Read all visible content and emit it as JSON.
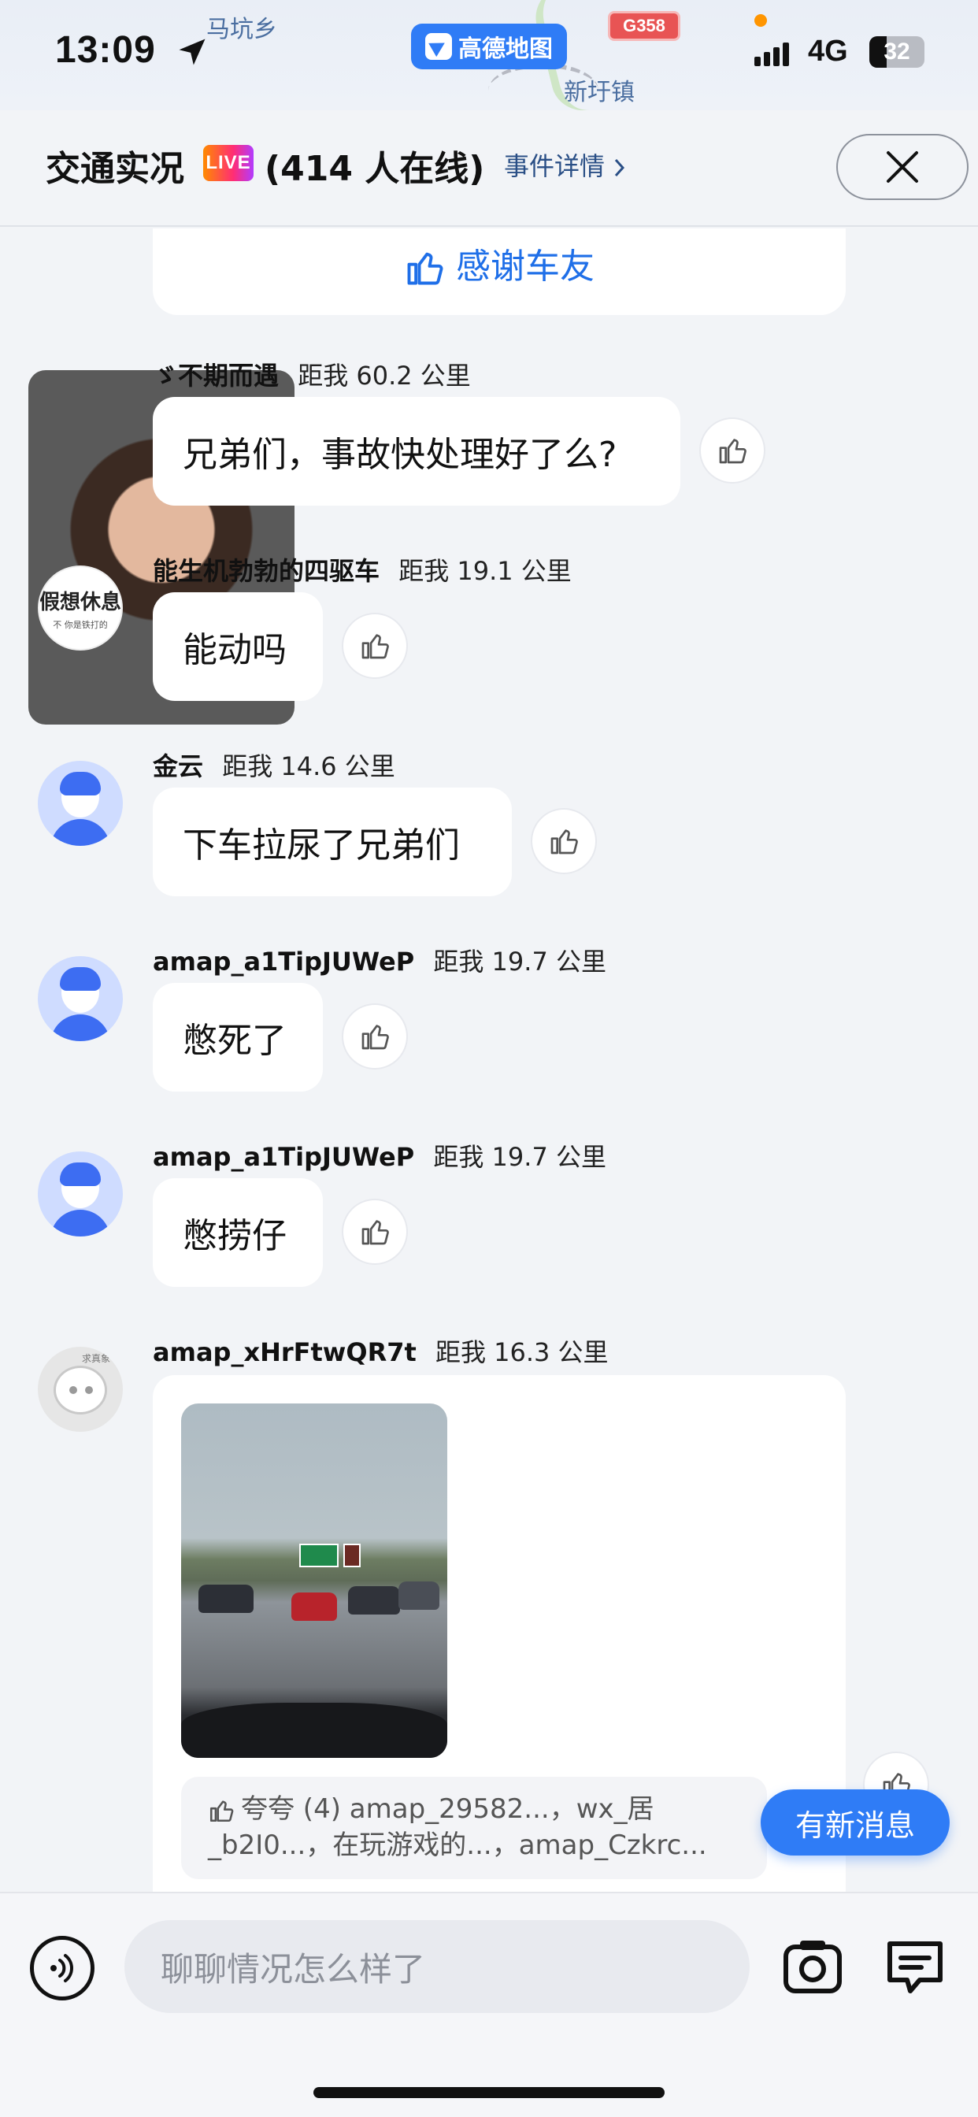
{
  "status": {
    "time": "13:09",
    "network": "4G",
    "battery": "32",
    "app_name": "高德地图",
    "road_badge": "G358",
    "map_labels": [
      "马坑乡",
      "新圩镇"
    ]
  },
  "header": {
    "title": "交通实况",
    "live_badge": "LIVE",
    "online": "(414 人在线)",
    "event_link": "事件详情"
  },
  "thanks_button": "感谢车友",
  "messages": [
    {
      "user": "ゞ不期而遇",
      "distance": "距我 60.2 公里",
      "text": "兄弟们，事故快处理好了么?",
      "avatar": "photo"
    },
    {
      "user": "能生机勃勃的四驱车",
      "distance": "距我 19.1 公里",
      "text": "能动吗",
      "avatar": "text",
      "avatar_text": "假想休息",
      "avatar_subtext": "不 你是铁打的"
    },
    {
      "user": "金云",
      "distance": "距我 14.6 公里",
      "text": "下车拉尿了兄弟们",
      "avatar": "default"
    },
    {
      "user": "amap_a1TipJUWeP",
      "distance": "距我 19.7 公里",
      "text": "憋死了",
      "avatar": "default"
    },
    {
      "user": "amap_a1TipJUWeP",
      "distance": "距我 19.7 公里",
      "text": "憋捞仔",
      "avatar": "default"
    },
    {
      "user": "amap_xHrFtwQR7t",
      "distance": "距我 16.3 公里",
      "avatar": "bot",
      "avatar_tag": "求真象",
      "praise_line1": "夸夸 (4) amap_29582...，wx_居",
      "praise_line2": "_b2I0...，在玩游戏的...，amap_Czkrc..."
    }
  ],
  "new_message_button": "有新消息",
  "composer": {
    "placeholder": "聊聊情况怎么样了"
  },
  "colors": {
    "accent": "#2f7cf6",
    "link": "#1f6fe8",
    "background": "#f2f4f7"
  },
  "icons": [
    "location-arrow-icon",
    "close-icon",
    "thumbs-up-icon",
    "voice-icon",
    "camera-icon",
    "chat-icon"
  ]
}
